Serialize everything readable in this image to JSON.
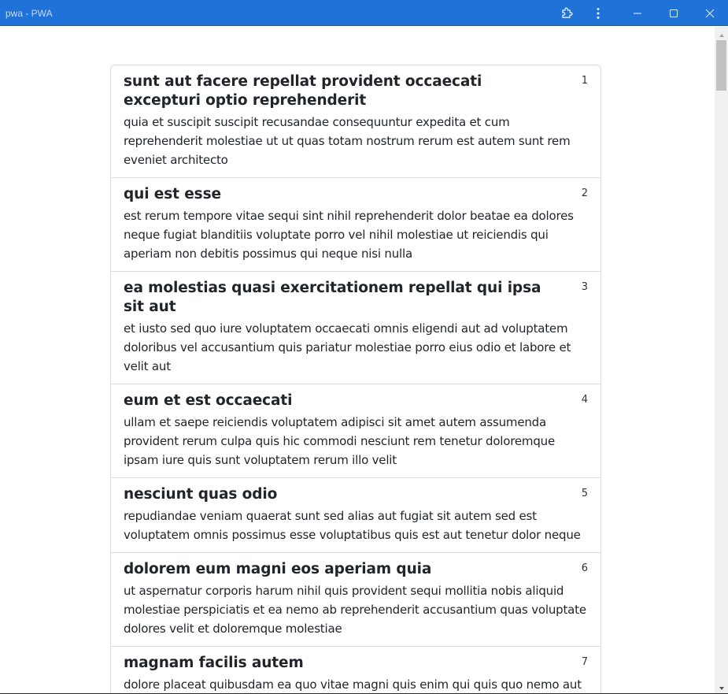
{
  "window": {
    "title": "pwa - PWA"
  },
  "colors": {
    "titlebar": "#1f73d8",
    "text": "#212529",
    "border": "#dcdcdc"
  },
  "titlebar_icons": [
    "extensions-icon",
    "more-vert-icon",
    "minimize-icon",
    "maximize-icon",
    "close-icon"
  ],
  "posts": [
    {
      "id": "1",
      "title": "sunt aut facere repellat provident occaecati excepturi optio reprehenderit",
      "body": "quia et suscipit suscipit recusandae consequuntur expedita et cum reprehenderit molestiae ut ut quas totam nostrum rerum est autem sunt rem eveniet architecto"
    },
    {
      "id": "2",
      "title": "qui est esse",
      "body": "est rerum tempore vitae sequi sint nihil reprehenderit dolor beatae ea dolores neque fugiat blanditiis voluptate porro vel nihil molestiae ut reiciendis qui aperiam non debitis possimus qui neque nisi nulla"
    },
    {
      "id": "3",
      "title": "ea molestias quasi exercitationem repellat qui ipsa sit aut",
      "body": "et iusto sed quo iure voluptatem occaecati omnis eligendi aut ad voluptatem doloribus vel accusantium quis pariatur molestiae porro eius odio et labore et velit aut"
    },
    {
      "id": "4",
      "title": "eum et est occaecati",
      "body": "ullam et saepe reiciendis voluptatem adipisci sit amet autem assumenda provident rerum culpa quis hic commodi nesciunt rem tenetur doloremque ipsam iure quis sunt voluptatem rerum illo velit"
    },
    {
      "id": "5",
      "title": "nesciunt quas odio",
      "body": "repudiandae veniam quaerat sunt sed alias aut fugiat sit autem sed est voluptatem omnis possimus esse voluptatibus quis est aut tenetur dolor neque"
    },
    {
      "id": "6",
      "title": "dolorem eum magni eos aperiam quia",
      "body": "ut aspernatur corporis harum nihil quis provident sequi mollitia nobis aliquid molestiae perspiciatis et ea nemo ab reprehenderit accusantium quas voluptate dolores velit et doloremque molestiae"
    },
    {
      "id": "7",
      "title": "magnam facilis autem",
      "body": "dolore placeat quibusdam ea quo vitae magni quis enim qui quis quo nemo aut saepe quidem repellat excepturi ut quia sunt ut sequi eos ea sed quas"
    }
  ]
}
